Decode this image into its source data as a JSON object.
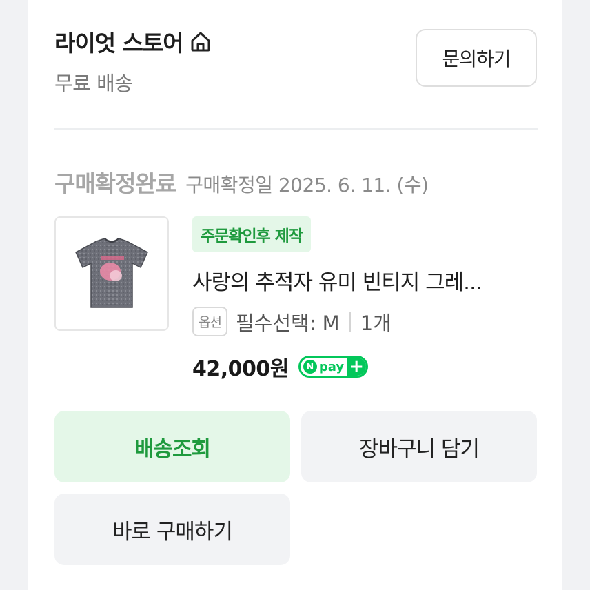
{
  "store": {
    "name": "라이엇 스토어",
    "shipping": "무료 배송",
    "inquiry_label": "문의하기"
  },
  "order": {
    "status": "구매확정완료",
    "confirm_date": "구매확정일 2025. 6. 11. (수)"
  },
  "product": {
    "tag": "주문확인후 제작",
    "name": "사랑의 추적자 유미 빈티지 그레...",
    "option_badge": "옵션",
    "option_text": "필수선택: M",
    "quantity": "1개",
    "price": "42,000원",
    "pay_brand": "pay",
    "pay_n": "N",
    "pay_plus": "+"
  },
  "actions": {
    "track_label": "배송조회",
    "cart_label": "장바구니 담기",
    "buy_label": "바로 구매하기"
  },
  "colors": {
    "accent_green": "#1f9a3e",
    "npay_green": "#03c75a",
    "tag_bg": "#e4f7e8"
  },
  "icons": {
    "home": "home-icon",
    "product_image": "tshirt-image"
  }
}
